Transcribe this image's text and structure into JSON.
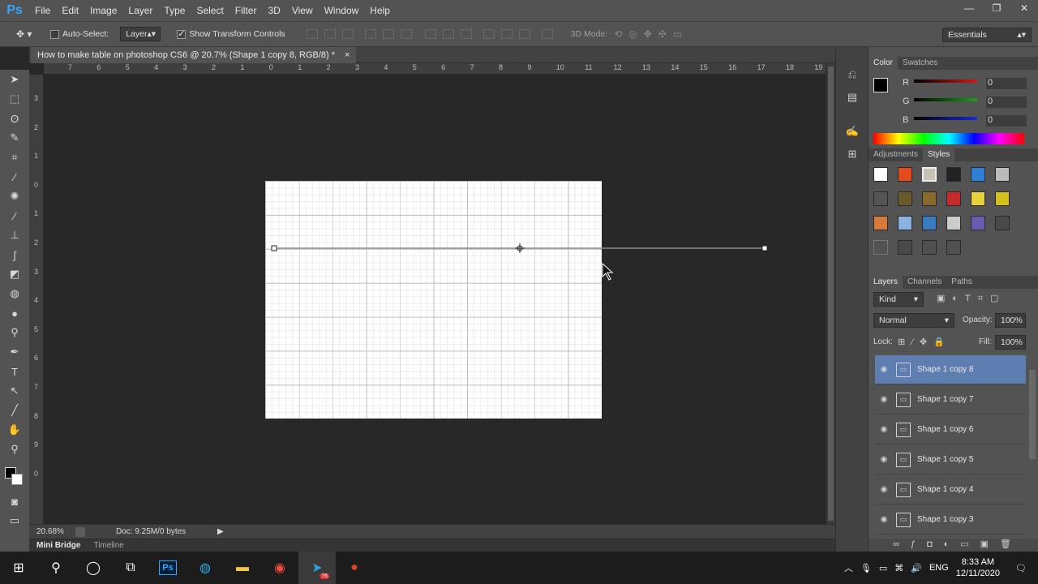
{
  "app": {
    "logo": "Ps"
  },
  "menu": [
    "File",
    "Edit",
    "Image",
    "Layer",
    "Type",
    "Select",
    "Filter",
    "3D",
    "View",
    "Window",
    "Help"
  ],
  "window_controls": {
    "minimize": "—",
    "restore": "❐",
    "close": "✕"
  },
  "options": {
    "auto_select_label": "Auto-Select:",
    "auto_select_value": "Layer",
    "transform_label": "Show Transform Controls",
    "mode_3d_label": "3D Mode:",
    "workspace": "Essentials"
  },
  "document": {
    "tab_title": "How to make table on photoshop CS6 @ 20.7% (Shape 1 copy 8, RGB/8) *",
    "close": "×"
  },
  "ruler": {
    "h_ticks": [
      "7",
      "6",
      "5",
      "4",
      "3",
      "2",
      "1",
      "0",
      "1",
      "2",
      "3",
      "4",
      "5",
      "6",
      "7",
      "8",
      "9",
      "10",
      "11",
      "12",
      "13",
      "14",
      "15",
      "16",
      "17",
      "18",
      "19"
    ],
    "v_ticks": [
      "3",
      "2",
      "1",
      "0",
      "1",
      "2",
      "3",
      "4",
      "5",
      "6",
      "7",
      "8",
      "9",
      "0"
    ]
  },
  "status": {
    "zoom": "20.68%",
    "doc": "Doc: 9.25M/0 bytes"
  },
  "bottom_tabs": [
    "Mini Bridge",
    "Timeline"
  ],
  "color_panel": {
    "tabs": [
      "Color",
      "Swatches"
    ],
    "channels": [
      {
        "label": "R",
        "value": "0",
        "color": "#d11a1a"
      },
      {
        "label": "G",
        "value": "0",
        "color": "#1aa01a"
      },
      {
        "label": "B",
        "value": "0",
        "color": "#1a2ad1"
      }
    ]
  },
  "styles_panel": {
    "tabs": [
      "Adjustments",
      "Styles"
    ]
  },
  "layers_panel": {
    "tabs": [
      "Layers",
      "Channels",
      "Paths"
    ],
    "kind": "Kind",
    "blend_mode": "Normal",
    "opacity_label": "Opacity:",
    "opacity": "100%",
    "lock_label": "Lock:",
    "fill_label": "Fill:",
    "fill": "100%",
    "layers": [
      {
        "name": "Shape 1 copy 8",
        "selected": true
      },
      {
        "name": "Shape 1 copy 7",
        "selected": false
      },
      {
        "name": "Shape 1 copy 6",
        "selected": false
      },
      {
        "name": "Shape 1 copy 5",
        "selected": false
      },
      {
        "name": "Shape 1 copy 4",
        "selected": false
      },
      {
        "name": "Shape 1 copy 3",
        "selected": false
      }
    ]
  },
  "taskbar": {
    "time": "8:33 AM",
    "date": "12/11/2020",
    "lang": "ENG",
    "badge": "76"
  },
  "colors": {
    "accent": "#5e7db1",
    "ps_blue": "#31a8ff"
  }
}
